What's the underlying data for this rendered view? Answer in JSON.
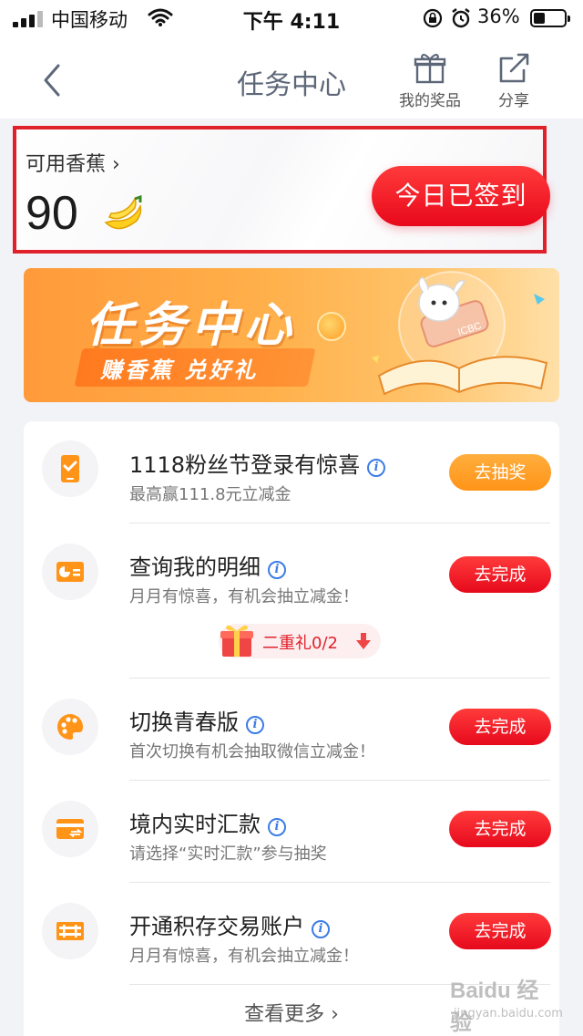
{
  "status_bar": {
    "carrier": "中国移动",
    "time": "下午 4:11",
    "battery": "36%"
  },
  "nav": {
    "title": "任务中心",
    "prizes_label": "我的奖品",
    "share_label": "分享"
  },
  "points": {
    "label": "可用香蕉",
    "value": "90",
    "checkin_label": "今日已签到"
  },
  "banner": {
    "title": "任务中心",
    "subtitle": "赚香蕉 兑好礼",
    "brand": "ICBC"
  },
  "tasks": [
    {
      "title": "1118粉丝节登录有惊喜",
      "desc": "最高赢111.8元立减金",
      "button": "去抽奖",
      "icon": "phone-check-icon",
      "button_color": "#ff9f24"
    },
    {
      "title": "查询我的明细",
      "desc": "月月有惊喜，有机会抽立减金！",
      "button": "去完成",
      "icon": "chart-card-icon",
      "button_color": "#ef1424",
      "bonus": "二重礼0/2"
    },
    {
      "title": "切换青春版",
      "desc": "首次切换有机会抽取微信立减金！",
      "button": "去完成",
      "icon": "palette-icon",
      "button_color": "#ef1424"
    },
    {
      "title": "境内实时汇款",
      "desc": "请选择“实时汇款”参与抽奖",
      "button": "去完成",
      "icon": "transfer-card-icon",
      "button_color": "#ef1424"
    },
    {
      "title": "开通积存交易账户",
      "desc": "月月有惊喜，有机会抽立减金！",
      "button": "去完成",
      "icon": "gold-bars-icon",
      "button_color": "#ef1424"
    }
  ],
  "view_more": "查看更多",
  "watermark": {
    "line1": "Baidu 经验",
    "line2": "jingyan.baidu.com"
  }
}
